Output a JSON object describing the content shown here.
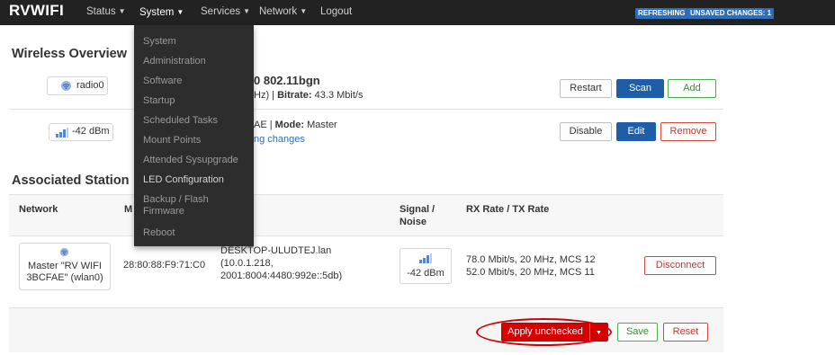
{
  "brand": "RVWIFI",
  "nav": {
    "status": "Status",
    "system": "System",
    "services": "Services",
    "network": "Network",
    "logout": "Logout"
  },
  "badges": {
    "refreshing": "REFRESHING",
    "unsaved": "UNSAVED CHANGES: 1"
  },
  "system_menu": [
    "System",
    "Administration",
    "Software",
    "Startup",
    "Scheduled Tasks",
    "Mount Points",
    "Attended Sysupgrade",
    "LED Configuration",
    "Backup / Flash Firmware",
    "Reboot"
  ],
  "wireless": {
    "heading": "Wireless Overview",
    "radio": {
      "badge": "radio0",
      "title_partial": "0 802.11bgn",
      "info_partial": "Hz) | ",
      "bitrate_label": "Bitrate:",
      "bitrate_value": " 43.3 Mbit/s",
      "buttons": {
        "restart": "Restart",
        "scan": "Scan",
        "add": "Add"
      }
    },
    "network": {
      "signal": "-42 dBm",
      "info_partial": "AE | ",
      "mode_label": "Mode:",
      "mode_value": " Master",
      "link_partial": "ng changes",
      "buttons": {
        "disable": "Disable",
        "edit": "Edit",
        "remove": "Remove"
      }
    }
  },
  "stations": {
    "heading": "Associated Station",
    "columns": {
      "network": "Network",
      "mac_partial": "M",
      "signal_line1": "Signal /",
      "signal_line2": "Noise",
      "rate": "RX Rate / TX Rate"
    },
    "row": {
      "network_line1": "Master \"RV WIFI",
      "network_line2": "3BCFAE\" (wlan0)",
      "mac": "28:80:88:F9:71:C0",
      "host_line1": "DESKTOP-ULUDTEJ.lan",
      "host_line2": "(10.0.1.218,",
      "host_line3": "2001:8004:4480:992e::5db)",
      "signal": "-42 dBm",
      "rx": "78.0 Mbit/s, 20 MHz, MCS 12",
      "tx": "52.0 Mbit/s, 20 MHz, MCS 11",
      "disconnect": "Disconnect"
    }
  },
  "footer": {
    "apply": "Apply unchecked",
    "save": "Save",
    "reset": "Reset"
  }
}
